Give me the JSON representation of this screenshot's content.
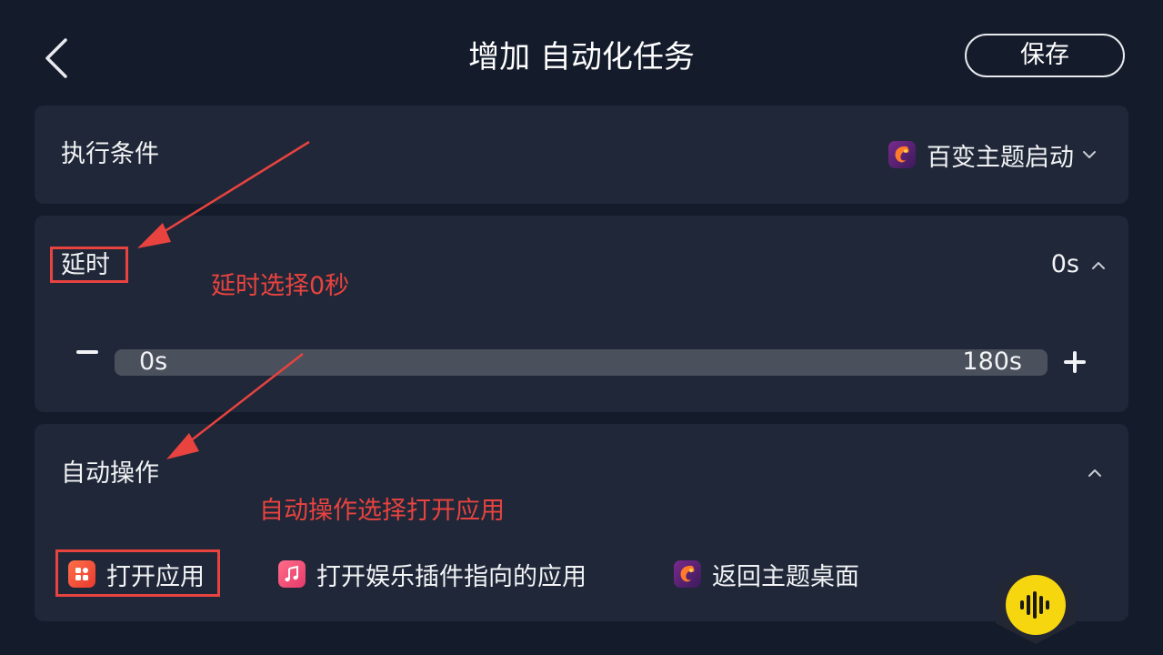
{
  "header": {
    "back_icon": "chevron-left-icon",
    "title": "增加 自动化任务",
    "save_label": "保存"
  },
  "condition": {
    "label": "执行条件",
    "selected_app": "百变主题启动",
    "dropdown_icon": "chevron-down-icon"
  },
  "delay": {
    "label": "延时",
    "value": "0s",
    "collapse_icon": "chevron-up-icon",
    "min_label": "0s",
    "max_label": "180s",
    "slider_value_seconds": 0,
    "decrease_icon": "minus-icon",
    "increase_icon": "plus-icon"
  },
  "auto_action": {
    "label": "自动操作",
    "collapse_icon": "chevron-up-icon",
    "options": [
      {
        "label": "打开应用",
        "icon": "app-grid-icon",
        "selected": true
      },
      {
        "label": "打开娱乐插件指向的应用",
        "icon": "music-note-icon",
        "selected": false
      },
      {
        "label": "返回主题桌面",
        "icon": "theme-app-icon",
        "selected": false
      }
    ]
  },
  "annotations": {
    "delay_note": "延时选择0秒",
    "action_note": "自动操作选择打开应用"
  },
  "voice_assistant": {
    "icon": "sound-wave-icon"
  },
  "colors": {
    "background": "#141b2b",
    "card": "#1f2738",
    "slider_track": "#4a505c",
    "annotation_red": "#e8433f",
    "voice_yellow": "#f5d60f"
  }
}
